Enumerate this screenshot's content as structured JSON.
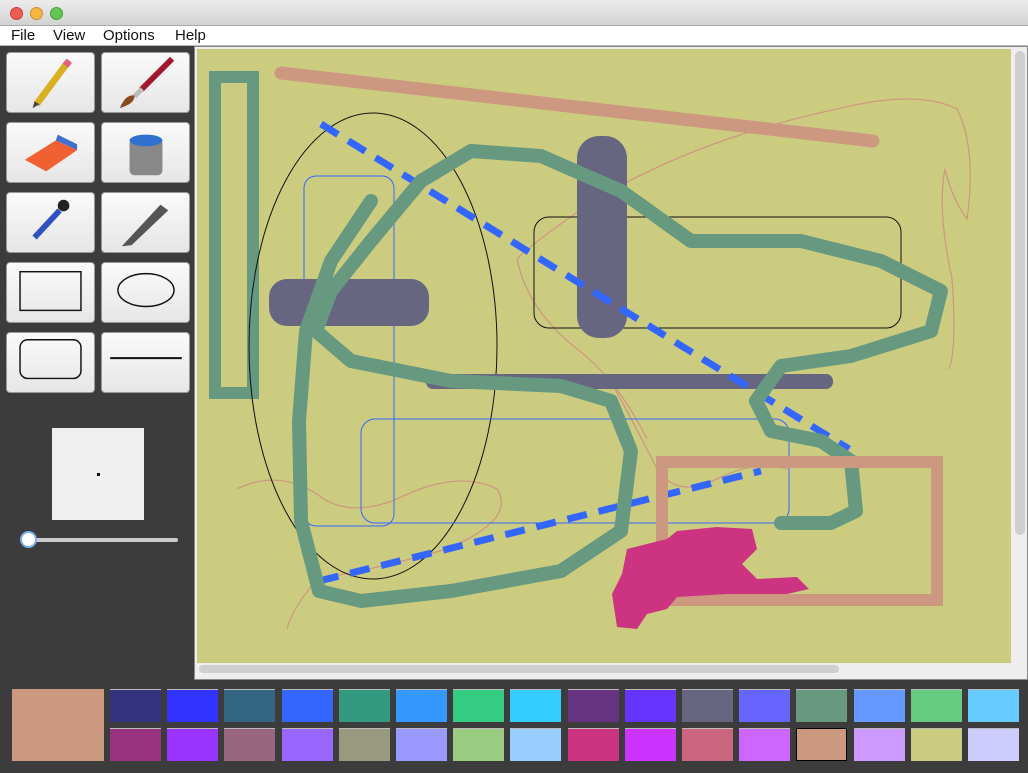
{
  "window": {
    "buttons": [
      "close",
      "minimize",
      "zoom"
    ]
  },
  "menu": [
    "File",
    "View",
    "Options",
    "Help"
  ],
  "tools": [
    {
      "name": "pencil-tool",
      "icon": "pencil-icon"
    },
    {
      "name": "brush-tool",
      "icon": "brush-icon"
    },
    {
      "name": "eraser-tool",
      "icon": "eraser-icon"
    },
    {
      "name": "fill-tool",
      "icon": "paint-bucket-icon"
    },
    {
      "name": "eyedropper-tool",
      "icon": "eyedropper-icon"
    },
    {
      "name": "calligraphy-tool",
      "icon": "calligraphy-pen-icon"
    },
    {
      "name": "rectangle-tool",
      "icon": "rectangle-icon"
    },
    {
      "name": "ellipse-tool",
      "icon": "ellipse-icon"
    },
    {
      "name": "rounded-rect-tool",
      "icon": "rounded-rectangle-icon"
    },
    {
      "name": "line-tool",
      "icon": "line-icon"
    }
  ],
  "brush_size": 0.03,
  "colors": {
    "canvas": "#cccc80",
    "current": "#cc9980"
  },
  "palette": [
    [
      "#333380",
      "#3333ff",
      "#336680",
      "#3366ff",
      "#33997f",
      "#3399ff",
      "#33cc80",
      "#33ccff",
      "#663380",
      "#6633ff",
      "#666680",
      "#6666ff",
      "#669980",
      "#6699ff",
      "#66cc80",
      "#66ccff"
    ],
    [
      "#993380",
      "#9933ff",
      "#996680",
      "#9966ff",
      "#999980",
      "#9999ff",
      "#99cc80",
      "#99ccff",
      "#cc3380",
      "#cc33ff",
      "#cc6680",
      "#cc66ff",
      "#cc9980",
      "#cc99ff",
      "#cccc80",
      "#ccccff"
    ]
  ]
}
